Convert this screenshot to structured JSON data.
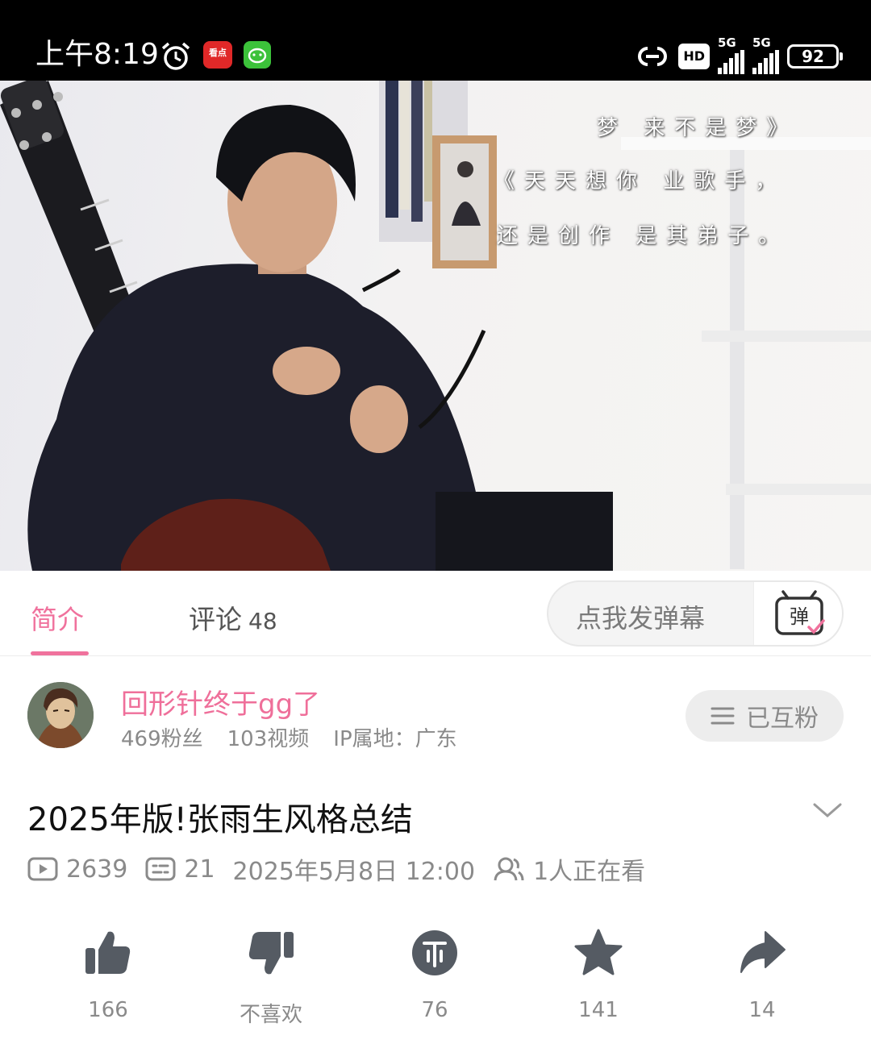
{
  "status_bar": {
    "time": "上午8:19",
    "app1_label": "看点",
    "hd_label": "HD",
    "network_1": "5G",
    "network_2": "5G",
    "battery": "92"
  },
  "video": {
    "lyric_line1": "梦 来不是梦》",
    "lyric_line2": "《天天想你 业歌手，",
    "lyric_line3": "还是创作 是其弟子。"
  },
  "tabs": {
    "intro_label": "简介",
    "comments_label": "评论",
    "comments_count": "48",
    "danmaku_placeholder": "点我发弹幕",
    "danmaku_icon_label": "弹"
  },
  "uploader": {
    "name": "回形针终于gg了",
    "fans": "469粉丝",
    "videos": "103视频",
    "ip": "IP属地：广东",
    "follow_label": "已互粉"
  },
  "video_info": {
    "title": "2025年版!张雨生风格总结",
    "views": "2639",
    "danmaku_count": "21",
    "date": "2025年5月8日 12:00",
    "watching": "1人正在看"
  },
  "actions": {
    "like": "166",
    "dislike": "不喜欢",
    "coin": "76",
    "favorite": "141",
    "share": "14"
  },
  "colors": {
    "accent": "#f0729d",
    "icon_gray": "#555b63",
    "text_gray": "#8a8a8a"
  }
}
